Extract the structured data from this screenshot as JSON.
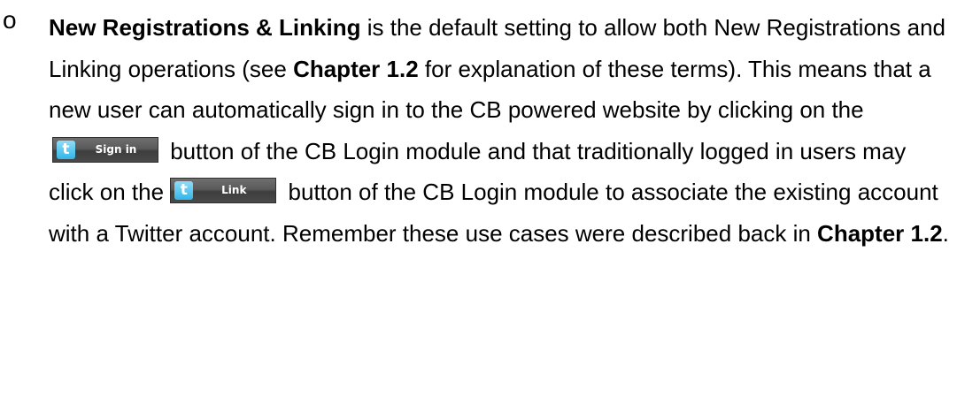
{
  "bullet": "o",
  "paragraph": {
    "term_1": "New Registrations & Linking",
    "text_1": " is the default setting to allow both New Registrations and Linking operations (see ",
    "term_2": "Chapter 1.2",
    "text_2": " for explanation of these terms). This means that a new user can automatically sign in to the CB powered website by clicking on the ",
    "text_3": " button of the CB Login module and that traditionally logged in users may click on the ",
    "text_4": " button of the CB Login module to associate the existing account with a Twitter account. Remember these use cases were described back in ",
    "term_3": "Chapter 1.2",
    "text_5": "."
  },
  "buttons": {
    "signin": {
      "icon": "twitter-t-icon",
      "icon_glyph": "t",
      "label": "Sign in"
    },
    "link": {
      "icon": "twitter-t-icon",
      "icon_glyph": "t",
      "label": "Link"
    }
  },
  "colors": {
    "button_bg": "#4f4f4f",
    "twitter_blue": "#33b6e8"
  }
}
